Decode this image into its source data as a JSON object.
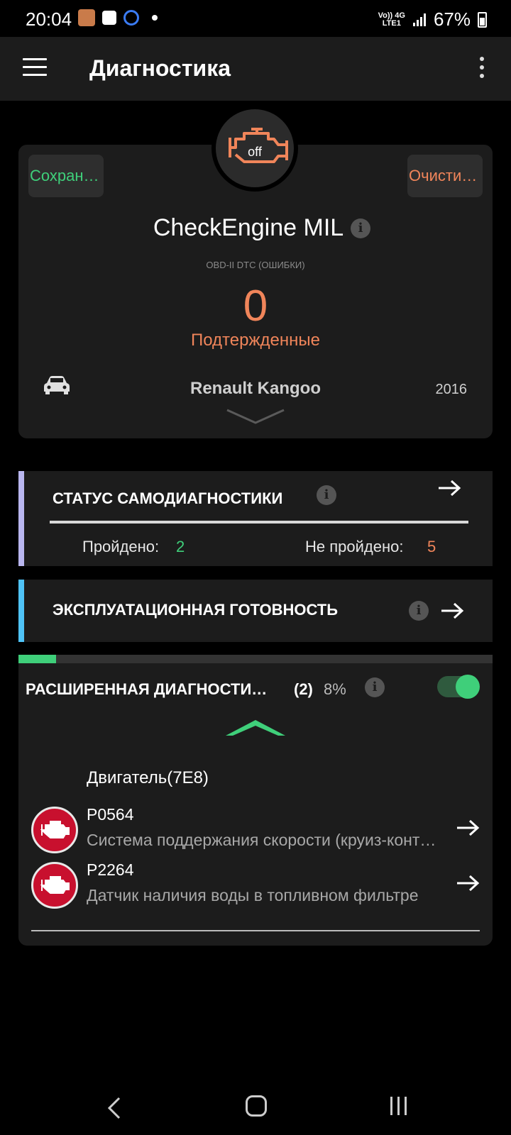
{
  "status_bar": {
    "time": "20:04",
    "network_top": "Vo)) 4G",
    "network_bottom": "LTE1",
    "battery": "67%"
  },
  "app_bar": {
    "title": "Диагностика"
  },
  "engine_status": {
    "state": "off",
    "icon": "check-engine-icon",
    "color": "#f0855a"
  },
  "main_card": {
    "save_label": "Сохран…",
    "clear_label": "Очисти…",
    "mil_title": "CheckEngine MIL",
    "dtc_subtitle": "OBD-II DTC (ОШИБКИ)",
    "dtc_count": "0",
    "confirmed_label": "Подтержденные",
    "car_name": "Renault Kangoo",
    "car_year": "2016"
  },
  "self_diagnostics": {
    "title": "СТАТУС САМОДИАГНОСТИКИ",
    "passed_label": "Пройдено:",
    "passed_value": "2",
    "failed_label": "Не пройдено:",
    "failed_value": "5",
    "accent": "#b9b6ef"
  },
  "readiness": {
    "title": "ЭКСПЛУАТАЦИОННАЯ ГОТОВНОСТЬ",
    "accent": "#4fc3f7"
  },
  "extended": {
    "title": "РАСШИРЕННАЯ ДИАГНОСТИ…",
    "count": "(2)",
    "percent": "8%",
    "progress": 0.08,
    "toggle_on": true,
    "ecu_label": "Двигатель(7E8)",
    "codes": [
      {
        "code": "P0564",
        "description": "Система поддержания скорости (круиз-контроль)"
      },
      {
        "code": "P2264",
        "description": "Датчик наличия воды в топливном фильтре"
      }
    ]
  },
  "colors": {
    "green": "#3fcf7a",
    "orange": "#f0855a",
    "card_bg": "#1c1c1c",
    "dtc_badge": "#c8102e"
  }
}
